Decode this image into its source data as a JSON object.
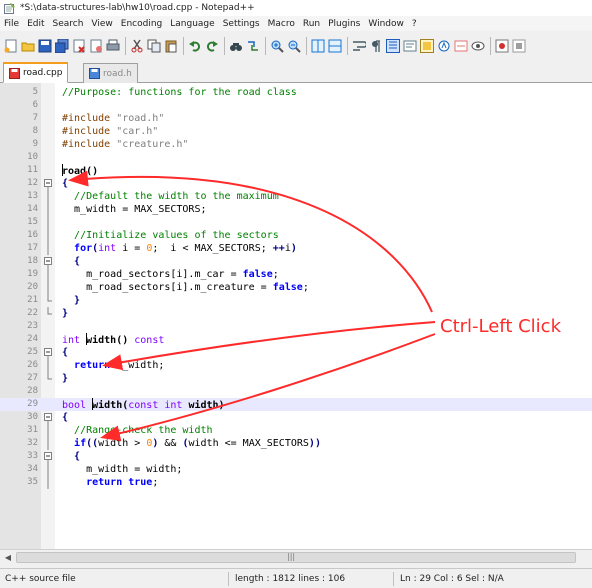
{
  "window": {
    "title": "*S:\\data-structures-lab\\hw10\\road.cpp - Notepad++"
  },
  "menu": [
    "File",
    "Edit",
    "Search",
    "View",
    "Encoding",
    "Language",
    "Settings",
    "Macro",
    "Run",
    "Plugins",
    "Window",
    "?"
  ],
  "tabs": [
    {
      "label": "road.cpp",
      "state": "active"
    },
    {
      "label": "road.h",
      "state": "inactive"
    }
  ],
  "lines": [
    {
      "n": "5",
      "segs": [
        [
          "cm",
          "//Purpose: functions for the road class"
        ]
      ]
    },
    {
      "n": "6",
      "segs": []
    },
    {
      "n": "7",
      "segs": [
        [
          "pp",
          "#include "
        ],
        [
          "str",
          "\"road.h\""
        ]
      ]
    },
    {
      "n": "8",
      "segs": [
        [
          "pp",
          "#include "
        ],
        [
          "str",
          "\"car.h\""
        ]
      ]
    },
    {
      "n": "9",
      "segs": [
        [
          "pp",
          "#include "
        ],
        [
          "str",
          "\"creature.h\""
        ]
      ]
    },
    {
      "n": "10",
      "segs": []
    },
    {
      "n": "11",
      "segs": [
        [
          "caret",
          ""
        ],
        [
          "fn",
          "road()"
        ]
      ]
    },
    {
      "n": "12",
      "segs": [
        [
          "op",
          "{"
        ]
      ]
    },
    {
      "n": "13",
      "segs": [
        [
          "",
          "  "
        ],
        [
          "cm",
          "//Default the width to the maximum"
        ]
      ]
    },
    {
      "n": "14",
      "segs": [
        [
          "",
          "  m_width = MAX_SECTORS;"
        ]
      ]
    },
    {
      "n": "15",
      "segs": []
    },
    {
      "n": "16",
      "segs": [
        [
          "",
          "  "
        ],
        [
          "cm",
          "//Initialize values of the sectors"
        ]
      ]
    },
    {
      "n": "17",
      "segs": [
        [
          "",
          "  "
        ],
        [
          "kw",
          "for"
        ],
        [
          "op",
          "("
        ],
        [
          "ty",
          "int"
        ],
        [
          "",
          " i = "
        ],
        [
          "num",
          "0"
        ],
        [
          "",
          ";  i < MAX_SECTORS; "
        ],
        [
          "op",
          "++"
        ],
        [
          "",
          "i"
        ],
        [
          "op",
          ")"
        ]
      ]
    },
    {
      "n": "18",
      "segs": [
        [
          "",
          "  "
        ],
        [
          "op",
          "{"
        ]
      ]
    },
    {
      "n": "19",
      "segs": [
        [
          "",
          "    m_road_sectors[i].m_car = "
        ],
        [
          "kw",
          "false"
        ],
        [
          "",
          ";"
        ]
      ]
    },
    {
      "n": "20",
      "segs": [
        [
          "",
          "    m_road_sectors[i].m_creature = "
        ],
        [
          "kw",
          "false"
        ],
        [
          "",
          ";"
        ]
      ]
    },
    {
      "n": "21",
      "segs": [
        [
          "",
          "  "
        ],
        [
          "op",
          "}"
        ]
      ]
    },
    {
      "n": "22",
      "segs": [
        [
          "op",
          "}"
        ]
      ]
    },
    {
      "n": "23",
      "segs": []
    },
    {
      "n": "24",
      "segs": [
        [
          "ty",
          "int "
        ],
        [
          "caret",
          ""
        ],
        [
          "fn",
          "width() "
        ],
        [
          "ty",
          "const"
        ]
      ]
    },
    {
      "n": "25",
      "segs": [
        [
          "op",
          "{"
        ]
      ]
    },
    {
      "n": "26",
      "segs": [
        [
          "",
          "  "
        ],
        [
          "kw",
          "return"
        ],
        [
          "",
          " m_width;"
        ]
      ]
    },
    {
      "n": "27",
      "segs": [
        [
          "op",
          "}"
        ]
      ]
    },
    {
      "n": "28",
      "segs": []
    },
    {
      "n": "29",
      "segs": [
        [
          "ty",
          "bool "
        ],
        [
          "caret",
          ""
        ],
        [
          "fn",
          "width("
        ],
        [
          "ty",
          "const int"
        ],
        [
          "fn",
          " width)"
        ]
      ]
    },
    {
      "n": "30",
      "segs": [
        [
          "op",
          "{"
        ]
      ]
    },
    {
      "n": "31",
      "segs": [
        [
          "",
          "  "
        ],
        [
          "cm",
          "//Range-check the width"
        ]
      ]
    },
    {
      "n": "32",
      "segs": [
        [
          "",
          "  "
        ],
        [
          "kw",
          "if"
        ],
        [
          "op",
          "(("
        ],
        [
          "",
          "width > "
        ],
        [
          "num",
          "0"
        ],
        [
          "op",
          ")"
        ],
        [
          "",
          " && "
        ],
        [
          "op",
          "("
        ],
        [
          "",
          "width <= MAX_SECTORS"
        ],
        [
          "op",
          "))"
        ]
      ]
    },
    {
      "n": "33",
      "segs": [
        [
          "",
          "  "
        ],
        [
          "op",
          "{"
        ]
      ]
    },
    {
      "n": "34",
      "segs": [
        [
          "",
          "    m_width = width;"
        ]
      ]
    },
    {
      "n": "35",
      "segs": [
        [
          "",
          "    "
        ],
        [
          "kw",
          "return true"
        ],
        [
          "",
          ";"
        ]
      ]
    }
  ],
  "status": {
    "filetype": "C++ source file",
    "length": "length : 1812   lines : 106",
    "position": "Ln : 29   Col : 6   Sel : N/A"
  },
  "annotation": {
    "text": "Ctrl-Left Click",
    "color": "#ff2a2a"
  }
}
